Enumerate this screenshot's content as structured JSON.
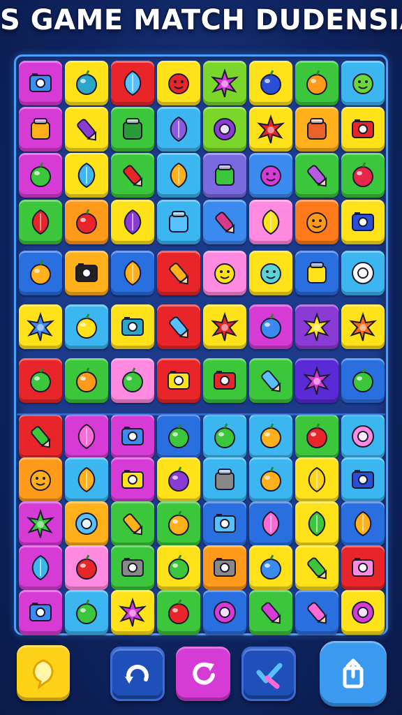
{
  "header": {
    "title": "S GAME MATCH DUDENSIA"
  },
  "colors": {
    "background": "#0f2461",
    "board_border": "#4aa0ff",
    "board_fill": "#1b3a8a"
  },
  "board": {
    "columns": 8,
    "rows": 12,
    "tiles": [
      [
        {
          "bg": "#d63bd6",
          "icon": "tablet-icon",
          "fg": "#3a8ff0"
        },
        {
          "bg": "#ffe21a",
          "icon": "robot-head-icon",
          "fg": "#2aa6c8"
        },
        {
          "bg": "#e8262a",
          "icon": "crystal-icon",
          "fg": "#58c0ff"
        },
        {
          "bg": "#ffe21a",
          "icon": "red-blob-face-icon",
          "fg": "#e8262a"
        },
        {
          "bg": "#7ad62a",
          "icon": "starburst-icon",
          "fg": "#d63bd6"
        },
        {
          "bg": "#ffe21a",
          "icon": "blue-ball-icon",
          "fg": "#2a4fd6"
        },
        {
          "bg": "#3bc63b",
          "icon": "orange-fruit-icon",
          "fg": "#ff9a1a"
        },
        {
          "bg": "#3bb6f0",
          "icon": "alien-face-icon",
          "fg": "#6ad63b"
        }
      ],
      [
        {
          "bg": "#d63bd6",
          "icon": "box-icon",
          "fg": "#ffb01a"
        },
        {
          "bg": "#ffe21a",
          "icon": "crayon-icon",
          "fg": "#8a3bd6"
        },
        {
          "bg": "#3bc63b",
          "icon": "backpack-icon",
          "fg": "#2a9a3b"
        },
        {
          "bg": "#3bb6f0",
          "icon": "candy-icon",
          "fg": "#8a5ae0"
        },
        {
          "bg": "#7ad62a",
          "icon": "target-ring-icon",
          "fg": "#8a3bd6"
        },
        {
          "bg": "#ffe21a",
          "icon": "flower-icon",
          "fg": "#e8262a"
        },
        {
          "bg": "#ffb01a",
          "icon": "shoe-icon",
          "fg": "#e8622a"
        },
        {
          "bg": "#ffe21a",
          "icon": "radio-icon",
          "fg": "#e8262a"
        }
      ],
      [
        {
          "bg": "#d63bd6",
          "icon": "green-ball-icon",
          "fg": "#3bc63b"
        },
        {
          "bg": "#ffe21a",
          "icon": "gem-icon",
          "fg": "#3bb6f0"
        },
        {
          "bg": "#3bc63b",
          "icon": "red-crayon-icon",
          "fg": "#e8262a"
        },
        {
          "bg": "#3bb6f0",
          "icon": "shell-icon",
          "fg": "#ffb01a"
        },
        {
          "bg": "#7a6ae0",
          "icon": "cube-icon",
          "fg": "#3bc63b"
        },
        {
          "bg": "#3b8af0",
          "icon": "pink-face-icon",
          "fg": "#d63bd6"
        },
        {
          "bg": "#3bc63b",
          "icon": "purple-crayon-icon",
          "fg": "#b85ae0"
        },
        {
          "bg": "#3bc63b",
          "icon": "lollipop-icon",
          "fg": "#e8264a"
        }
      ],
      [
        {
          "bg": "#3bc63b",
          "icon": "leaf-icon",
          "fg": "#e8262a"
        },
        {
          "bg": "#ff9a1a",
          "icon": "ball-icon",
          "fg": "#e8262a"
        },
        {
          "bg": "#ffe21a",
          "icon": "purple-candy-icon",
          "fg": "#8a3bd6"
        },
        {
          "bg": "#3bb6f0",
          "icon": "cup-icon",
          "fg": "#58c0ff"
        },
        {
          "bg": "#3b8af0",
          "icon": "radish-icon",
          "fg": "#d63b8a"
        },
        {
          "bg": "#ff8ae0",
          "icon": "lemon-icon",
          "fg": "#ffe21a"
        },
        {
          "bg": "#ff7a1a",
          "icon": "pumpkin-icon",
          "fg": "#ff9a1a"
        },
        {
          "bg": "#ffe21a",
          "icon": "jar-icon",
          "fg": "#2a4fd6"
        }
      ],
      [
        {
          "bg": "#2a6fe0",
          "icon": "cookie-icon",
          "fg": "#ffb01a"
        },
        {
          "bg": "#ffb01a",
          "icon": "camera-icon",
          "fg": "#222222"
        },
        {
          "bg": "#2a6fe0",
          "icon": "hand-icon",
          "fg": "#ffb01a"
        },
        {
          "bg": "#e8262a",
          "icon": "carrot-icon",
          "fg": "#ffb01a"
        },
        {
          "bg": "#ff8ae0",
          "icon": "smile-face-icon",
          "fg": "#ffe21a"
        },
        {
          "bg": "#ffe21a",
          "icon": "monster-face-icon",
          "fg": "#58d6d6"
        },
        {
          "bg": "#2a6fe0",
          "icon": "potion-icon",
          "fg": "#ffe21a"
        },
        {
          "bg": "#3bb6f0",
          "icon": "disc-icon",
          "fg": "#ffffff"
        }
      ],
      [
        {
          "bg": "#ffe21a",
          "icon": "gear-icon",
          "fg": "#3b8af0"
        },
        {
          "bg": "#3bb6f0",
          "icon": "pacman-icon",
          "fg": "#ffe21a"
        },
        {
          "bg": "#ffe21a",
          "icon": "phone-icon",
          "fg": "#2aa6c8"
        },
        {
          "bg": "#e8262a",
          "icon": "pencil-icon",
          "fg": "#58c0ff"
        },
        {
          "bg": "#ffe21a",
          "icon": "red-flower-icon",
          "fg": "#e8262a"
        },
        {
          "bg": "#d63bd6",
          "icon": "blue-robot-icon",
          "fg": "#3b8af0"
        },
        {
          "bg": "#8a3bd6",
          "icon": "sun-icon",
          "fg": "#ffe21a"
        },
        {
          "bg": "#ffe21a",
          "icon": "orange-sun-icon",
          "fg": "#ff6a1a"
        }
      ],
      [
        {
          "bg": "#e8262a",
          "icon": "turtle-icon",
          "fg": "#3bc63b"
        },
        {
          "bg": "#3bc63b",
          "icon": "orange-icon",
          "fg": "#ff9a1a"
        },
        {
          "bg": "#ff8ae0",
          "icon": "lime-icon",
          "fg": "#3bc63b"
        },
        {
          "bg": "#e8262a",
          "icon": "cassette-icon",
          "fg": "#ffe21a"
        },
        {
          "bg": "#3bc63b",
          "icon": "battery-icon",
          "fg": "#e8262a"
        },
        {
          "bg": "#3bc63b",
          "icon": "blue-pencil-icon",
          "fg": "#58c0ff"
        },
        {
          "bg": "#5a2ad6",
          "icon": "magenta-star-icon",
          "fg": "#d63bd6"
        },
        {
          "bg": "#2a6fe0",
          "icon": "apple-icon",
          "fg": "#3bc63b"
        }
      ],
      [
        {
          "bg": "#e8262a",
          "icon": "green-crayon-icon",
          "fg": "#3bc63b"
        },
        {
          "bg": "#d63bd6",
          "icon": "mushroom-icon",
          "fg": "#ff6ad6"
        },
        {
          "bg": "#d63bd6",
          "icon": "blue-camera-icon",
          "fg": "#3b8af0"
        },
        {
          "bg": "#2a6fe0",
          "icon": "green-apple-icon",
          "fg": "#3bc63b"
        },
        {
          "bg": "#3bb6f0",
          "icon": "green-pear-icon",
          "fg": "#3bc63b"
        },
        {
          "bg": "#3bb6f0",
          "icon": "onion-icon",
          "fg": "#ffb01a"
        },
        {
          "bg": "#3bc63b",
          "icon": "red-berry-icon",
          "fg": "#e8262a"
        },
        {
          "bg": "#3bb6f0",
          "icon": "donut-icon",
          "fg": "#ff8ae0"
        }
      ],
      [
        {
          "bg": "#ff9a1a",
          "icon": "orange-face-icon",
          "fg": "#ffb01a"
        },
        {
          "bg": "#3bb6f0",
          "icon": "jellyfish-icon",
          "fg": "#ffb01a"
        },
        {
          "bg": "#d63bd6",
          "icon": "tape-icon",
          "fg": "#ffe21a"
        },
        {
          "bg": "#ffe21a",
          "icon": "purple-ball-icon",
          "fg": "#8a3bd6"
        },
        {
          "bg": "#3bb6f0",
          "icon": "brush-icon",
          "fg": "#888888"
        },
        {
          "bg": "#3bb6f0",
          "icon": "peach-icon",
          "fg": "#ffb01a"
        },
        {
          "bg": "#ffe21a",
          "icon": "cheese-icon",
          "fg": "#ffd21a"
        },
        {
          "bg": "#3bb6f0",
          "icon": "grill-icon",
          "fg": "#2a4fd6"
        }
      ],
      [
        {
          "bg": "#d63bd6",
          "icon": "spiky-ball-icon",
          "fg": "#3bc63b"
        },
        {
          "bg": "#ffb01a",
          "icon": "ring-icon",
          "fg": "#58c0ff"
        },
        {
          "bg": "#3bc63b",
          "icon": "orange-crayon-icon",
          "fg": "#ffb01a"
        },
        {
          "bg": "#3bc63b",
          "icon": "cookie-dots-icon",
          "fg": "#ffb01a"
        },
        {
          "bg": "#2a6fe0",
          "icon": "speaker-icon",
          "fg": "#58c0ff"
        },
        {
          "bg": "#2a6fe0",
          "icon": "pink-hand-icon",
          "fg": "#ff6ad6"
        },
        {
          "bg": "#ffe21a",
          "icon": "green-leaf-icon",
          "fg": "#3bc63b"
        },
        {
          "bg": "#2a6fe0",
          "icon": "cheese-block-icon",
          "fg": "#ffb01a"
        }
      ],
      [
        {
          "bg": "#d63bd6",
          "icon": "feather-icon",
          "fg": "#3bb6f0"
        },
        {
          "bg": "#ff8ae0",
          "icon": "strawberry-icon",
          "fg": "#e8262a"
        },
        {
          "bg": "#3bc63b",
          "icon": "gameboy-icon",
          "fg": "#888888"
        },
        {
          "bg": "#ffe21a",
          "icon": "green-orb-icon",
          "fg": "#3bc63b"
        },
        {
          "bg": "#ff9a1a",
          "icon": "tape-deck-icon",
          "fg": "#888888"
        },
        {
          "bg": "#ffe21a",
          "icon": "blue-fruit-icon",
          "fg": "#3b8af0"
        },
        {
          "bg": "#ffe21a",
          "icon": "leaf-crayon-icon",
          "fg": "#3bc63b"
        },
        {
          "bg": "#e8262a",
          "icon": "red-camera-icon",
          "fg": "#ff8ae0"
        }
      ],
      [
        {
          "bg": "#d63bd6",
          "icon": "photo-camera-icon",
          "fg": "#3b8af0"
        },
        {
          "bg": "#3bb6f0",
          "icon": "fish-icon",
          "fg": "#3bc63b"
        },
        {
          "bg": "#ffe21a",
          "icon": "purple-gear-icon",
          "fg": "#d63bd6"
        },
        {
          "bg": "#3bc63b",
          "icon": "tomato-icon",
          "fg": "#e8262a"
        },
        {
          "bg": "#2a6fe0",
          "icon": "swirl-icon",
          "fg": "#d63bd6"
        },
        {
          "bg": "#3bc63b",
          "icon": "magenta-crayon-icon",
          "fg": "#d63bd6"
        },
        {
          "bg": "#2a6fe0",
          "icon": "pink-eraser-icon",
          "fg": "#ff6ad6"
        },
        {
          "bg": "#ffe21a",
          "icon": "no-sign-icon",
          "fg": "#d63bd6"
        }
      ]
    ]
  },
  "toolbar": {
    "buttons": [
      {
        "name": "hint-lemon-button",
        "icon": "lemon-bubble-icon",
        "bg": "#ffd21a"
      },
      {
        "name": "undo-button",
        "icon": "undo-arrow-icon",
        "bg": "#1f4fb8"
      },
      {
        "name": "restart-button",
        "icon": "restart-circle-icon",
        "bg": "#d63bd6"
      },
      {
        "name": "check-button",
        "icon": "check-mark-icon",
        "bg": "#1f4fb8"
      },
      {
        "name": "share-button",
        "icon": "share-icon",
        "bg": "#3b9af0"
      }
    ]
  }
}
